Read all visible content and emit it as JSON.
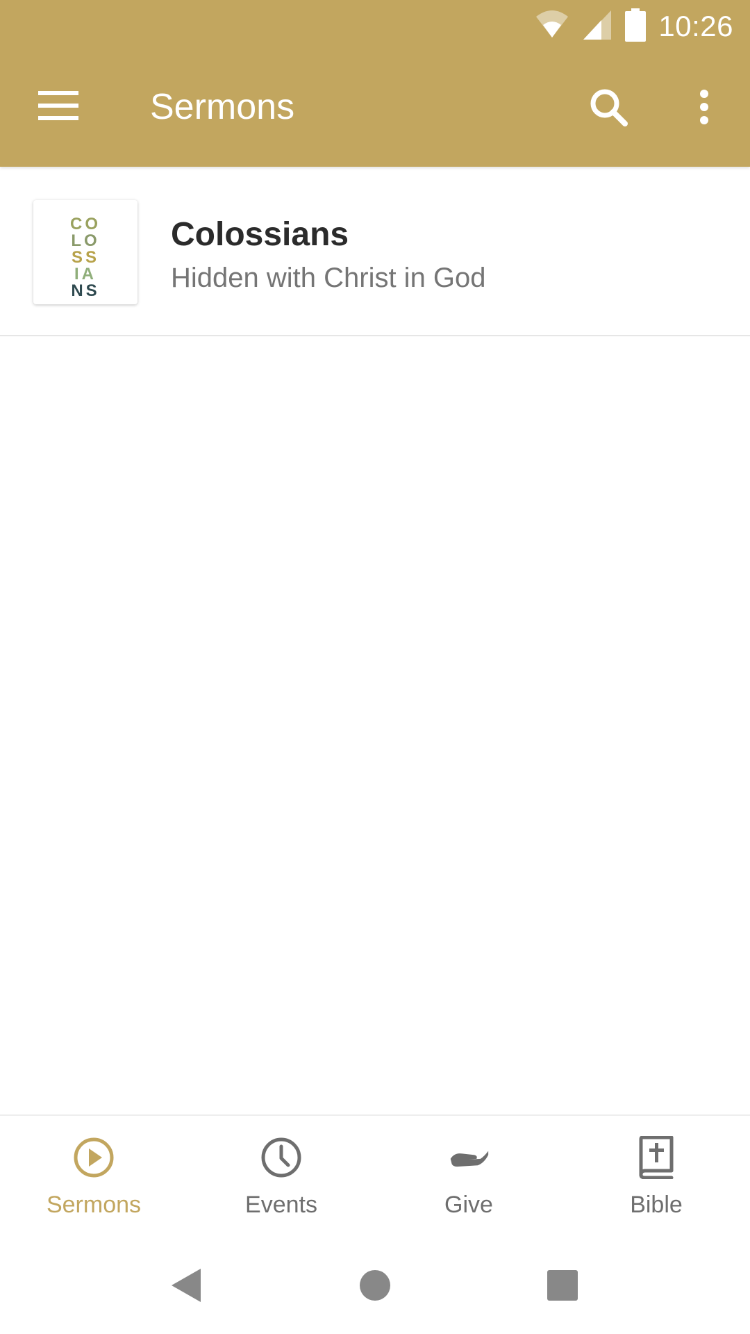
{
  "colors": {
    "primary": "#C2A65F",
    "text_primary": "#2b2b2b",
    "text_secondary": "#757575",
    "nav_inactive": "#6e6e6e"
  },
  "status_bar": {
    "time": "10:26",
    "icons": [
      "wifi-icon",
      "cell-signal-icon",
      "battery-icon"
    ]
  },
  "app_bar": {
    "title": "Sermons",
    "left_icon": "menu-icon",
    "right_icons": [
      "search-icon",
      "more-vert-icon"
    ]
  },
  "series": [
    {
      "title": "Colossians",
      "subtitle": "Hidden with Christ in God",
      "thumbnail_text": [
        "CO",
        "LO",
        "SS",
        "IA",
        "NS"
      ]
    }
  ],
  "bottom_nav": {
    "active": "Sermons",
    "tabs": [
      {
        "label": "Sermons",
        "icon": "play-circle-icon"
      },
      {
        "label": "Events",
        "icon": "clock-icon"
      },
      {
        "label": "Give",
        "icon": "giving-hand-icon"
      },
      {
        "label": "Bible",
        "icon": "bible-icon"
      }
    ]
  },
  "system_nav": {
    "icons": [
      "back-icon",
      "home-icon",
      "recents-icon"
    ]
  }
}
